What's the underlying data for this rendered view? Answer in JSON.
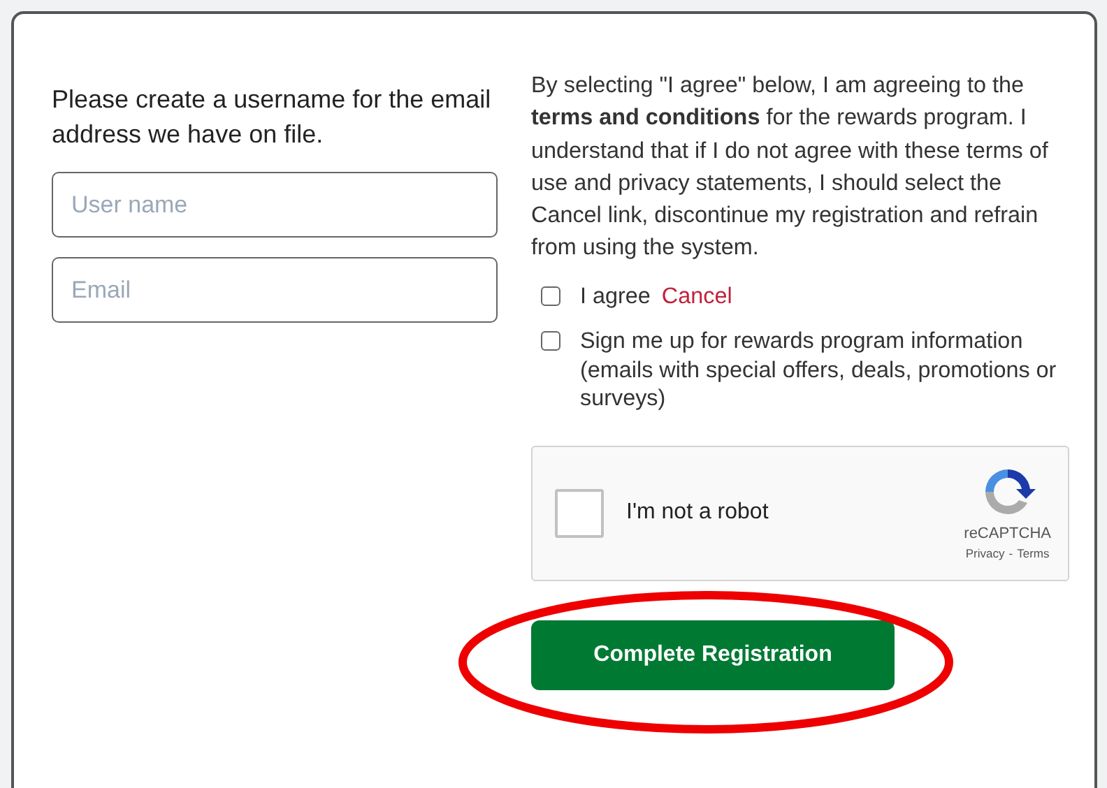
{
  "prompt": "Please create a username for the email address we have on file.",
  "fields": [
    {
      "placeholder": "User name"
    },
    {
      "placeholder": "Email"
    }
  ],
  "terms_text": "By selecting \"I agree\" below, I am agreeing to the **terms and conditions** for the rewards program. I understand that if I do not agree with these terms of use and privacy statements, I should select the Cancel link, discontinue my registration and refrain from using the system.",
  "checkboxes": [
    {
      "label": "I agree",
      "checked": false,
      "link": "Cancel"
    },
    {
      "label": "Sign me up for rewards program information (emails with special offers, deals, promotions or surveys)",
      "checked": false
    }
  ],
  "captcha": {
    "label": "I'm not a robot",
    "checked": false,
    "brand": "reCAPTCHA",
    "privacy": "Privacy",
    "separator": "-",
    "terms": "Terms"
  },
  "submit_button": "Complete Registration",
  "annotation": {
    "kind": "ellipse"
  }
}
